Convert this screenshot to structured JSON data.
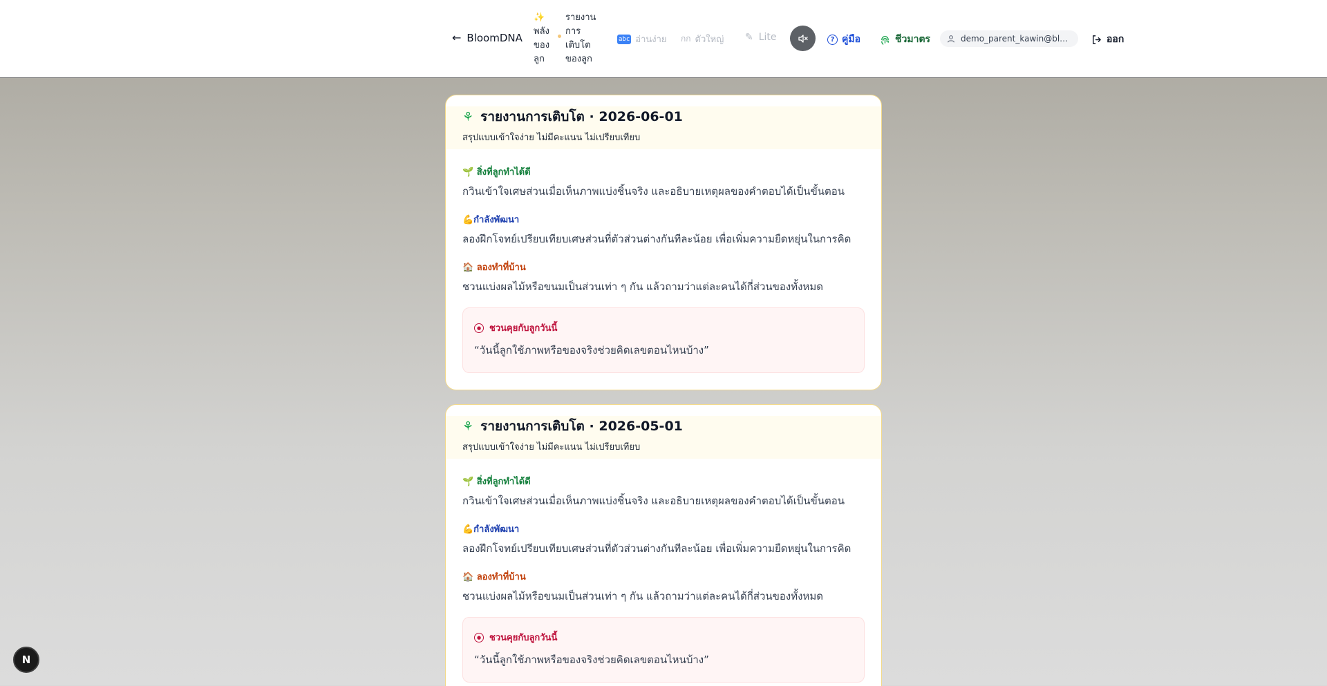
{
  "header": {
    "back_label": "BloomDNA",
    "tab_strength": "✨ พลังของลูก",
    "tab_report": "รายงานการเติบโตของลูก",
    "easy_read_badge": "abc",
    "easy_read_label": "อ่านง่าย",
    "big_font_icon": "กก",
    "big_font_label": "ตัวใหญ่",
    "lite_label": "Lite",
    "mute_icon": "speaker-mute-icon",
    "guide_label": "คู่มือ",
    "biometric_label": "ชีวมาตร",
    "user_email": "demo_parent_kawin@bloomdna.app",
    "logout_label": "ออก"
  },
  "reports": [
    {
      "title": "รายงานการเติบโต · 2026-06-01",
      "subtitle": "สรุปแบบเข้าใจง่าย ไม่มีคะแนน ไม่เปรียบเทียบ",
      "good_heading": "🌱 สิ่งที่ลูกทำได้ดี",
      "good_text": "กวินเข้าใจเศษส่วนเมื่อเห็นภาพแบ่งชิ้นจริง และอธิบายเหตุผลของคำตอบได้เป็นขั้นตอน",
      "grow_heading": "💪กำลังพัฒนา",
      "grow_text": "ลองฝึกโจทย์เปรียบเทียบเศษส่วนที่ตัวส่วนต่างกันทีละน้อย เพื่อเพิ่มความยืดหยุ่นในการคิด",
      "home_heading": "🏠 ลองทำที่บ้าน",
      "home_text": "ชวนแบ่งผลไม้หรือขนมเป็นส่วนเท่า ๆ กัน แล้วถามว่าแต่ละคนได้กี่ส่วนของทั้งหมด",
      "talk_heading": "ชวนคุยกับลูกวันนี้",
      "talk_text": "“วันนี้ลูกใช้ภาพหรือของจริงช่วยคิดเลขตอนไหนบ้าง”"
    },
    {
      "title": "รายงานการเติบโต · 2026-05-01",
      "subtitle": "สรุปแบบเข้าใจง่าย ไม่มีคะแนน ไม่เปรียบเทียบ",
      "good_heading": "🌱 สิ่งที่ลูกทำได้ดี",
      "good_text": "กวินเข้าใจเศษส่วนเมื่อเห็นภาพแบ่งชิ้นจริง และอธิบายเหตุผลของคำตอบได้เป็นขั้นตอน",
      "grow_heading": "💪กำลังพัฒนา",
      "grow_text": "ลองฝึกโจทย์เปรียบเทียบเศษส่วนที่ตัวส่วนต่างกันทีละน้อย เพื่อเพิ่มความยืดหยุ่นในการคิด",
      "home_heading": "🏠 ลองทำที่บ้าน",
      "home_text": "ชวนแบ่งผลไม้หรือขนมเป็นส่วนเท่า ๆ กัน แล้วถามว่าแต่ละคนได้กี่ส่วนของทั้งหมด",
      "talk_heading": "ชวนคุยกับลูกวันนี้",
      "talk_text": "“วันนี้ลูกใช้ภาพหรือของจริงช่วยคิดเลขตอนไหนบ้าง”"
    }
  ],
  "dev_badge": "N"
}
